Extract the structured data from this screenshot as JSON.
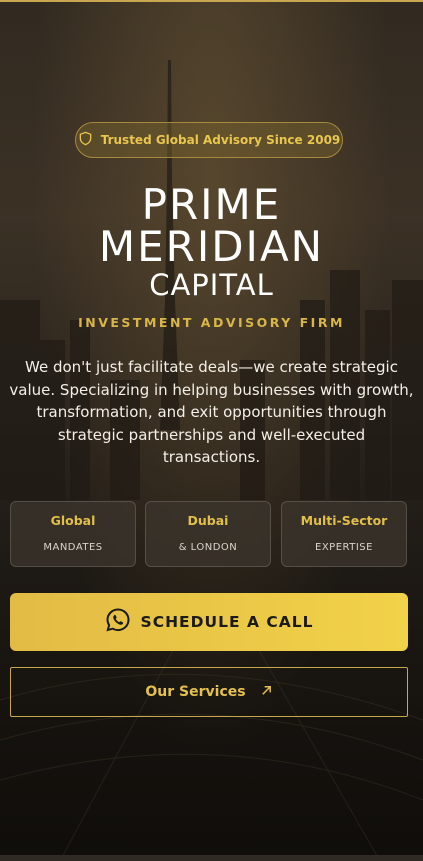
{
  "badge": {
    "text": "Trusted Global Advisory Since 2009",
    "icon": "shield-icon"
  },
  "brand": {
    "line1": "PRIME",
    "line2": "MERIDIAN",
    "line3": "CAPITAL"
  },
  "tagline": "INVESTMENT ADVISORY FIRM",
  "description": "We don't just facilitate deals—we create strategic value. Specializing in helping businesses with growth, transformation, and exit opportunities through strategic partnerships and well-executed transactions.",
  "stats": [
    {
      "value": "Global",
      "label": "MANDATES"
    },
    {
      "value": "Dubai",
      "label": "& LONDON"
    },
    {
      "value": "Multi-Sector",
      "label": "EXPERTISE"
    }
  ],
  "cta": {
    "label": "SCHEDULE A CALL",
    "icon": "whatsapp-icon"
  },
  "services": {
    "label": "Our Services",
    "icon": "arrow-up-right-icon"
  },
  "colors": {
    "gold": "#e2bf4b",
    "cta_start": "#e2bb45",
    "cta_end": "#f2d248",
    "background": "#2a241d"
  }
}
